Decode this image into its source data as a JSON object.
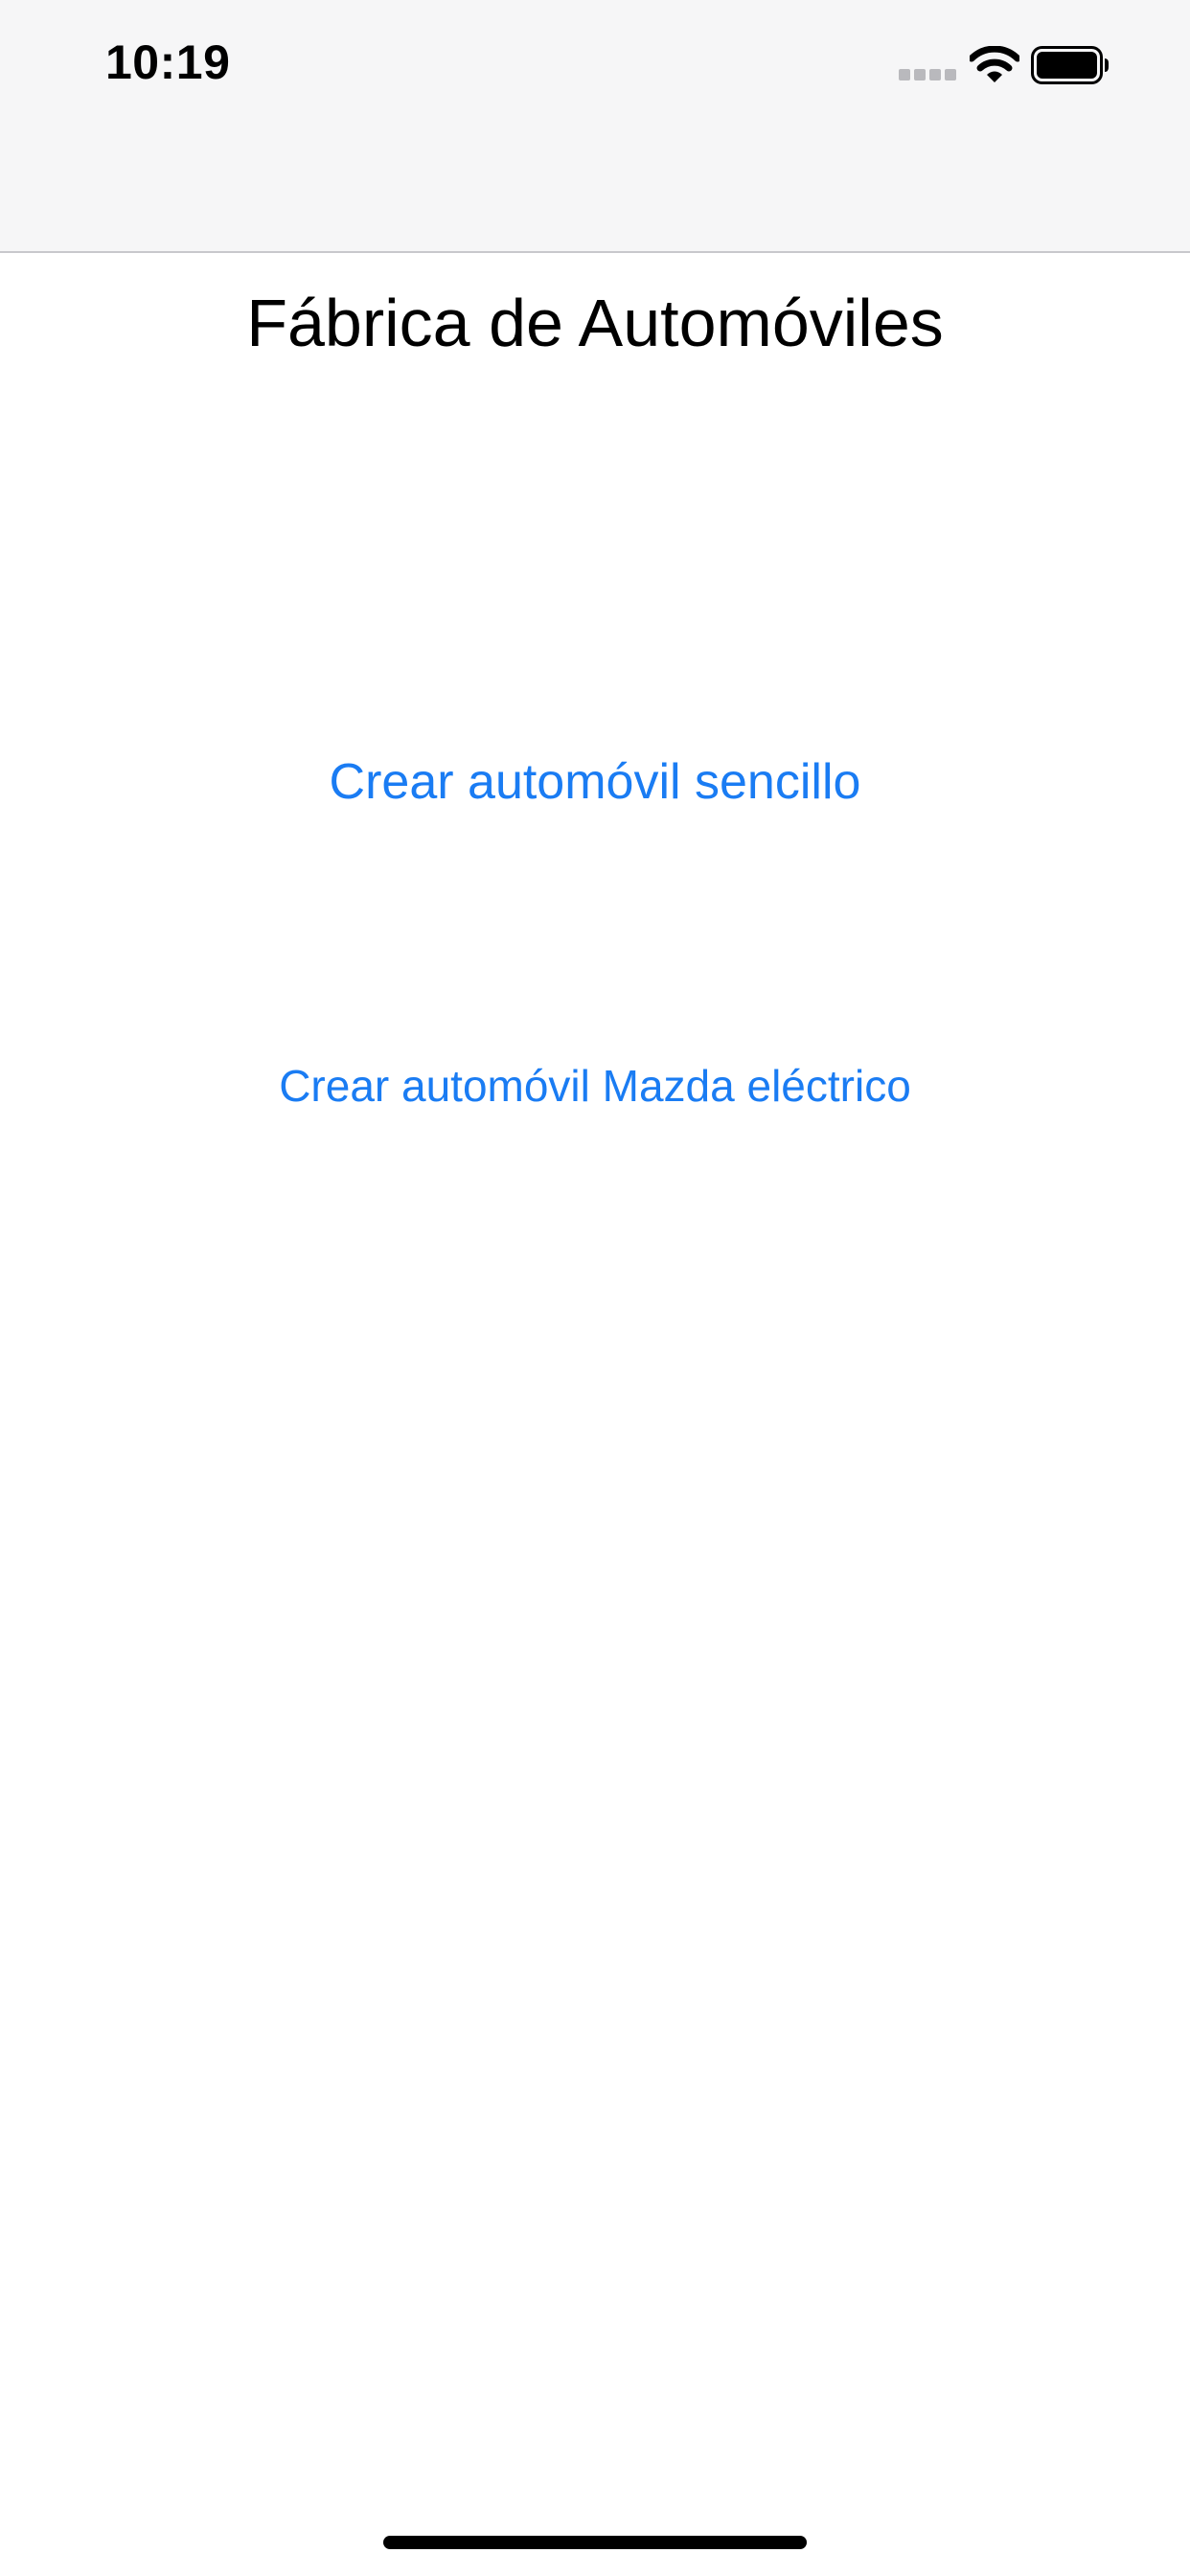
{
  "status_bar": {
    "time": "10:19",
    "icons": [
      "signal-icon",
      "wifi-icon",
      "battery-icon"
    ]
  },
  "page": {
    "title": "Fábrica de Automóviles"
  },
  "actions": {
    "create_simple_label": "Crear automóvil sencillo",
    "create_mazda_electric_label": "Crear automóvil Mazda eléctrico"
  },
  "colors": {
    "accent": "#1a7cf3",
    "status_bar_bg": "#f6f6f7",
    "background": "#ffffff"
  }
}
